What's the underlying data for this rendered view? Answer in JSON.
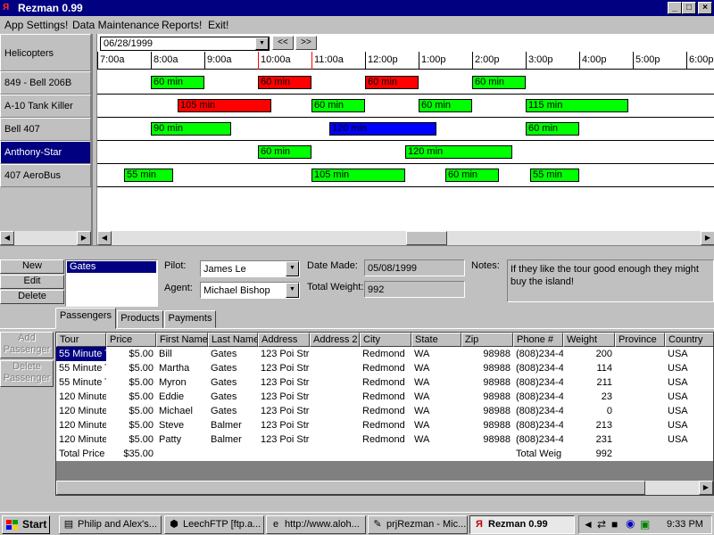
{
  "window": {
    "title": "Rezman 0.99",
    "controls": {
      "minimize": "_",
      "maximize": "□",
      "close": "×"
    }
  },
  "menu": [
    "App Settings!",
    "Data Maintenance",
    "Reports!",
    "Exit!"
  ],
  "resources": {
    "header": "Helicopters",
    "items": [
      "849 - Bell 206B",
      "A-10 Tank Killer",
      "Bell 407",
      "Anthony-Star",
      "407 AeroBus"
    ],
    "selected_index": 3
  },
  "schedule": {
    "date": "06/28/1999",
    "prev_label": "<<",
    "next_label": ">>",
    "times": [
      "7:00a",
      "8:00a",
      "9:00a",
      "10:00a",
      "11:00a",
      "12:00p",
      "1:00p",
      "2:00p",
      "3:00p",
      "4:00p",
      "5:00p",
      "6:00p"
    ],
    "colors": {
      "green": "#00ff00",
      "red": "#ff0000",
      "blue": "#0000ff"
    },
    "rows": [
      [
        {
          "label": "60 min",
          "color": "green"
        },
        {
          "label": "60 min",
          "color": "red"
        },
        {
          "label": "60 min",
          "color": "red"
        },
        {
          "label": "60 min",
          "color": "green"
        }
      ],
      [
        {
          "label": "105 min",
          "color": "red"
        },
        {
          "label": "60 min",
          "color": "green"
        },
        {
          "label": "60 min",
          "color": "green"
        },
        {
          "label": "115 min",
          "color": "green"
        }
      ],
      [
        {
          "label": "90 min",
          "color": "green"
        },
        {
          "label": "120 min",
          "color": "blue"
        },
        {
          "label": "60 min",
          "color": "green"
        }
      ],
      [
        {
          "label": "60 min",
          "color": "green"
        },
        {
          "label": "120 min",
          "color": "green"
        }
      ],
      [
        {
          "label": "55 min",
          "color": "green"
        },
        {
          "label": "105 min",
          "color": "green"
        },
        {
          "label": "60 min",
          "color": "green"
        },
        {
          "label": "55 min",
          "color": "green"
        }
      ]
    ]
  },
  "booking": {
    "buttons": {
      "new": "New",
      "edit": "Edit",
      "delete": "Delete"
    },
    "booking_list": [
      "Gates"
    ],
    "pilot_label": "Pilot:",
    "pilot": "James Le",
    "agent_label": "Agent:",
    "agent": "Michael Bishop",
    "date_made_label": "Date Made:",
    "date_made": "05/08/1999",
    "total_weight_label": "Total Weight:",
    "total_weight": "992",
    "notes_label": "Notes:",
    "notes": "If they like the tour good enough they might buy the island!"
  },
  "tabs": [
    "Passengers",
    "Products",
    "Payments"
  ],
  "passenger_buttons": {
    "add": "Add Passenger",
    "delete": "Delete Passenger"
  },
  "grid": {
    "columns": [
      "Tour",
      "Price",
      "First Name",
      "Last Name",
      "Address",
      "Address 2",
      "City",
      "State",
      "Zip",
      "Phone #",
      "Weight",
      "Province",
      "Country"
    ],
    "rows": [
      [
        "55 Minute T",
        "$5.00",
        "Bill",
        "Gates",
        "123 Poi Str",
        "",
        "Redmond",
        "WA",
        "98988",
        "(808)234-4",
        "200",
        "",
        "USA"
      ],
      [
        "55 Minute T",
        "$5.00",
        "Martha",
        "Gates",
        "123 Poi Str",
        "",
        "Redmond",
        "WA",
        "98988",
        "(808)234-4",
        "114",
        "",
        "USA"
      ],
      [
        "55 Minute T",
        "$5.00",
        "Myron",
        "Gates",
        "123 Poi Str",
        "",
        "Redmond",
        "WA",
        "98988",
        "(808)234-4",
        "211",
        "",
        "USA"
      ],
      [
        "120 Minute",
        "$5.00",
        "Eddie",
        "Gates",
        "123 Poi Str",
        "",
        "Redmond",
        "WA",
        "98988",
        "(808)234-4",
        "23",
        "",
        "USA"
      ],
      [
        "120 Minute",
        "$5.00",
        "Michael",
        "Gates",
        "123 Poi Str",
        "",
        "Redmond",
        "WA",
        "98988",
        "(808)234-4",
        "0",
        "",
        "USA"
      ],
      [
        "120 Minute",
        "$5.00",
        "Steve",
        "Balmer",
        "123 Poi Str",
        "",
        "Redmond",
        "WA",
        "98988",
        "(808)234-4",
        "213",
        "",
        "USA"
      ],
      [
        "120 Minute",
        "$5.00",
        "Patty",
        "Balmer",
        "123 Poi Str",
        "",
        "Redmond",
        "WA",
        "98988",
        "(808)234-4",
        "231",
        "",
        "USA"
      ]
    ],
    "total_price_label": "Total Price",
    "total_price": "$35.00",
    "total_weight_label": "Total Weig",
    "total_weight": "992"
  },
  "taskbar": {
    "start": "Start",
    "items": [
      {
        "label": "Philip and Alex's...",
        "icon": "document-icon"
      },
      {
        "label": "LeechFTP [ftp.a...",
        "icon": "ftp-icon"
      },
      {
        "label": "http://www.aloh...",
        "icon": "browser-icon"
      },
      {
        "label": "prjRezman - Mic...",
        "icon": "vb-project-icon"
      },
      {
        "label": "Rezman 0.99",
        "icon": "rezman-icon"
      }
    ],
    "clock": "9:33 PM"
  }
}
